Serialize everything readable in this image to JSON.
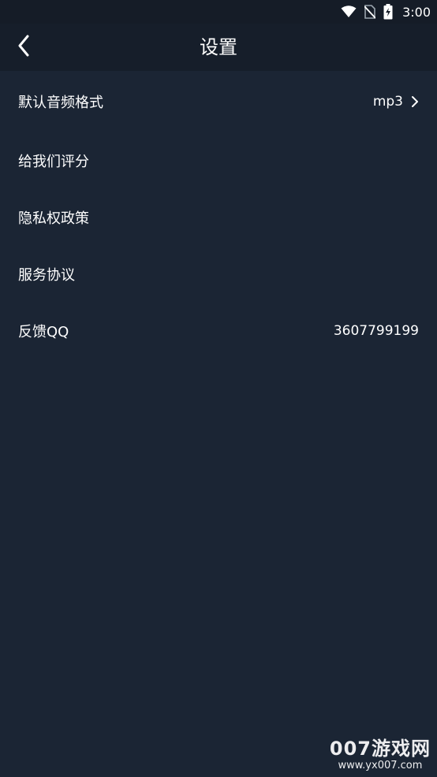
{
  "status_bar": {
    "time": "3:00",
    "icons": [
      "wifi-icon",
      "no-sim-icon",
      "battery-charging-icon"
    ]
  },
  "app_bar": {
    "back_icon": "chevron-left-icon",
    "title": "设置"
  },
  "settings": [
    {
      "label": "默认音频格式",
      "value": "mp3",
      "has_chevron": true
    },
    {
      "label": "给我们评分",
      "value": ""
    },
    {
      "label": "隐私权政策",
      "value": ""
    },
    {
      "label": "服务协议",
      "value": ""
    },
    {
      "label": "反馈QQ",
      "value": "3607799199"
    }
  ],
  "watermark": {
    "main": "007游戏网",
    "url": "www.yx007.com"
  },
  "colors": {
    "background": "#1b2534",
    "app_bar": "#161e2a",
    "status_bar": "#151c27",
    "text": "#ffffff"
  }
}
